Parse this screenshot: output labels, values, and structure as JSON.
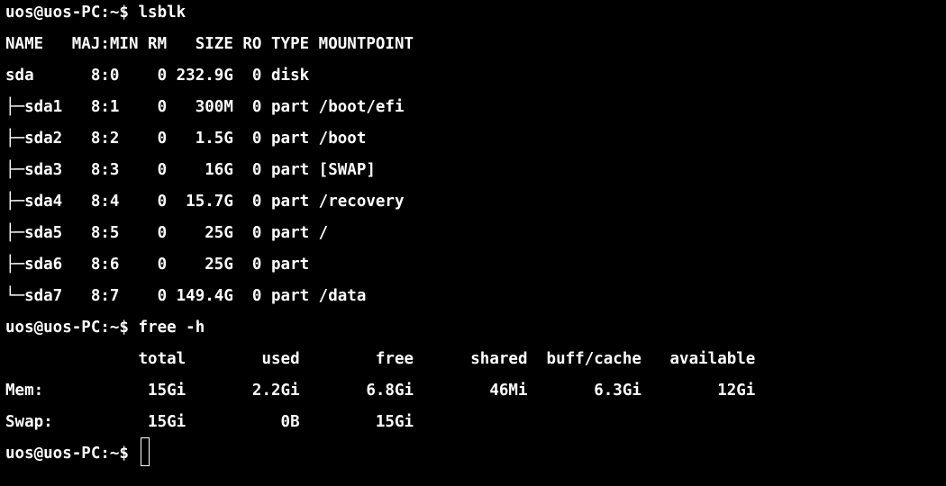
{
  "terminal": {
    "lines": [
      "uos@uos-PC:~$ lsblk",
      "NAME   MAJ:MIN RM   SIZE RO TYPE MOUNTPOINT",
      "sda      8:0    0 232.9G  0 disk",
      "├─sda1   8:1    0   300M  0 part /boot/efi",
      "├─sda2   8:2    0   1.5G  0 part /boot",
      "├─sda3   8:3    0    16G  0 part [SWAP]",
      "├─sda4   8:4    0  15.7G  0 part /recovery",
      "├─sda5   8:5    0    25G  0 part /",
      "├─sda6   8:6    0    25G  0 part",
      "└─sda7   8:7    0 149.4G  0 part /data",
      "uos@uos-PC:~$ free -h",
      "              total        used        free      shared  buff/cache   available",
      "Mem:           15Gi       2.2Gi       6.8Gi        46Mi       6.3Gi        12Gi",
      "Swap:          15Gi          0B        15Gi"
    ],
    "prompt": "uos@uos-PC:~$ "
  },
  "colors": {
    "background": "#000000",
    "foreground": "#ffffff"
  }
}
